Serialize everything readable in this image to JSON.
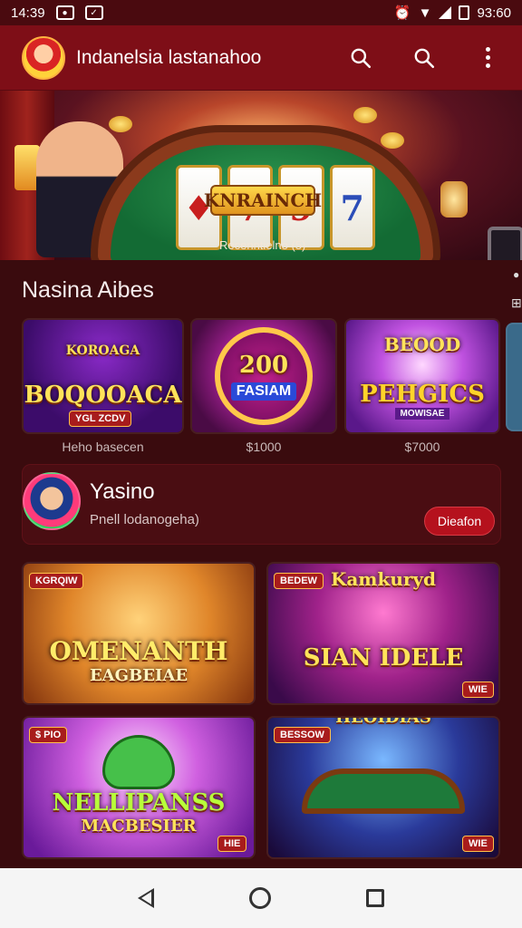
{
  "status": {
    "time": "14:39",
    "right_time": "93:60"
  },
  "app": {
    "title": "Indanelsia lastanahoo"
  },
  "hero": {
    "sign": "KNRAINCH",
    "caption": "Recenntielno (5)"
  },
  "section": {
    "title": "Nasina Aibes"
  },
  "featured": [
    {
      "title": "BOQOOACA",
      "top": "KOROAGA",
      "tag": "YGL ZCDV",
      "label": "Heho basecen"
    },
    {
      "title": "200",
      "sub": "FASIAM",
      "label": "$1000"
    },
    {
      "title": "PEHGICS",
      "top": "BEOOD",
      "sub": "MOWISAE",
      "label": "$7000"
    }
  ],
  "promo": {
    "title": "Yasino",
    "subtitle": "Pnell lodanogeha)",
    "button": "Dieafon"
  },
  "games": [
    {
      "tag": "KGRQIW",
      "title": "OMENANTH",
      "sub": "EAGBEIAE"
    },
    {
      "tag": "BEDEW",
      "top": "Kamkuryd",
      "title": "SIAN IDELE",
      "badge": "WIE"
    },
    {
      "tag": "$ PIO",
      "title": "NELLIPANSS",
      "sub": "MACBESIER",
      "badge": "HIE"
    },
    {
      "tag": "BESSOW",
      "top": "HEOIDIAS",
      "badge": "WIE"
    }
  ],
  "colors": {
    "appbar": "#7e0e17",
    "background": "#3a0b0e",
    "accent": "#b5111d"
  }
}
